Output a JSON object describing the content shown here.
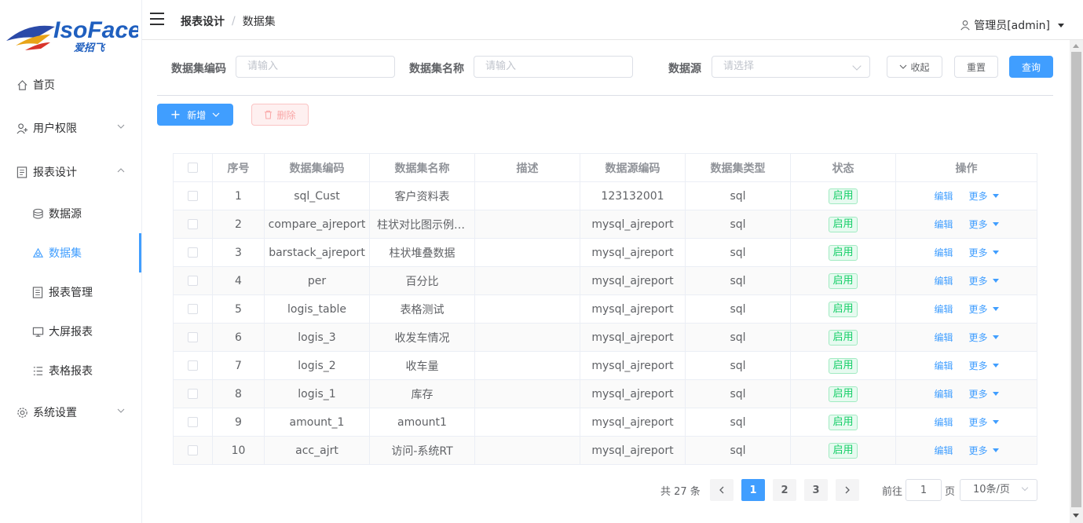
{
  "brand": {
    "logo_text": "IsoFace",
    "logo_sub": "爱招飞"
  },
  "header": {
    "breadcrumb": [
      "报表设计",
      "数据集"
    ],
    "breadcrumb_sep": "/",
    "user": "管理员[admin]"
  },
  "sidebar": {
    "items": [
      {
        "label": "首页",
        "icon": "home-icon"
      },
      {
        "label": "用户权限",
        "icon": "user-icon",
        "expandable": true
      },
      {
        "label": "报表设计",
        "icon": "report-icon",
        "expandable": true,
        "expanded": true
      },
      {
        "label": "数据源",
        "icon": "database-icon"
      },
      {
        "label": "数据集",
        "icon": "dataset-icon",
        "active": true
      },
      {
        "label": "报表管理",
        "icon": "report-manage-icon"
      },
      {
        "label": "大屏报表",
        "icon": "screen-icon"
      },
      {
        "label": "表格报表",
        "icon": "list-icon"
      },
      {
        "label": "系统设置",
        "icon": "gear-icon",
        "expandable": true
      }
    ]
  },
  "filter": {
    "code_label": "数据集编码",
    "code_placeholder": "请输入",
    "name_label": "数据集名称",
    "name_placeholder": "请输入",
    "source_label": "数据源",
    "source_placeholder": "请选择",
    "collapse_label": "收起",
    "reset_label": "重置",
    "query_label": "查询"
  },
  "toolbar": {
    "add_label": "新增",
    "delete_label": "删除"
  },
  "table": {
    "columns": [
      "序号",
      "数据集编码",
      "数据集名称",
      "描述",
      "数据源编码",
      "数据集类型",
      "状态",
      "操作"
    ],
    "rows": [
      {
        "no": "1",
        "code": "sql_Cust",
        "name": "客户资料表",
        "desc": "",
        "source": "123132001",
        "type": "sql",
        "status": "启用"
      },
      {
        "no": "2",
        "code": "compare_ajreport",
        "name": "柱状对比图示例数据",
        "desc": "",
        "source": "mysql_ajreport",
        "type": "sql",
        "status": "启用"
      },
      {
        "no": "3",
        "code": "barstack_ajreport",
        "name": "柱状堆叠数据",
        "desc": "",
        "source": "mysql_ajreport",
        "type": "sql",
        "status": "启用"
      },
      {
        "no": "4",
        "code": "per",
        "name": "百分比",
        "desc": "",
        "source": "mysql_ajreport",
        "type": "sql",
        "status": "启用"
      },
      {
        "no": "5",
        "code": "logis_table",
        "name": "表格测试",
        "desc": "",
        "source": "mysql_ajreport",
        "type": "sql",
        "status": "启用"
      },
      {
        "no": "6",
        "code": "logis_3",
        "name": "收发车情况",
        "desc": "",
        "source": "mysql_ajreport",
        "type": "sql",
        "status": "启用"
      },
      {
        "no": "7",
        "code": "logis_2",
        "name": "收车量",
        "desc": "",
        "source": "mysql_ajreport",
        "type": "sql",
        "status": "启用"
      },
      {
        "no": "8",
        "code": "logis_1",
        "name": "库存",
        "desc": "",
        "source": "mysql_ajreport",
        "type": "sql",
        "status": "启用"
      },
      {
        "no": "9",
        "code": "amount_1",
        "name": "amount1",
        "desc": "",
        "source": "mysql_ajreport",
        "type": "sql",
        "status": "启用"
      },
      {
        "no": "10",
        "code": "acc_ajrt",
        "name": "访问-系统RT",
        "desc": "",
        "source": "mysql_ajreport",
        "type": "sql",
        "status": "启用"
      }
    ],
    "edit_label": "编辑",
    "more_label": "更多"
  },
  "pagination": {
    "total_text": "共 27 条",
    "pages": [
      "1",
      "2",
      "3"
    ],
    "current": "1",
    "goto_label": "前往",
    "goto_value": "1",
    "page_unit": "页",
    "page_size": "10条/页"
  },
  "colors": {
    "primary": "#409eff",
    "success": "#13ce66",
    "danger": "#f56c6c"
  }
}
